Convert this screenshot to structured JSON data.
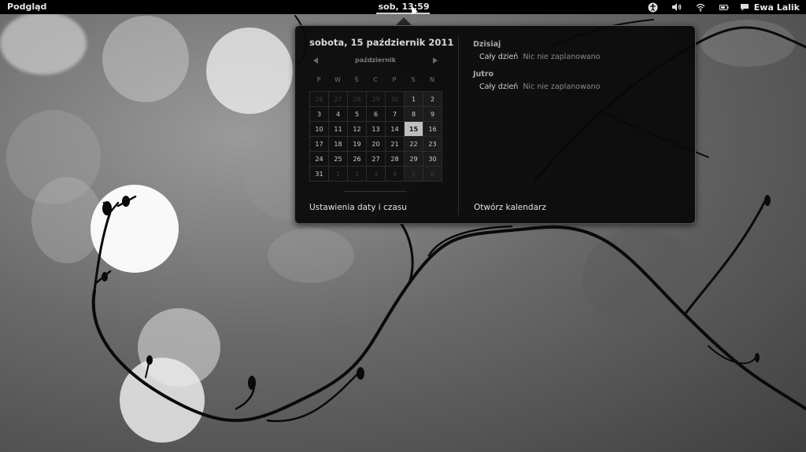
{
  "top_panel": {
    "activities_label": "Podgląd",
    "clock": "sob, 13:59",
    "user_name": "Ewa Lalik",
    "status_icons": [
      "accessibility-icon",
      "volume-icon",
      "wifi-icon",
      "battery-icon",
      "chat-icon"
    ]
  },
  "calendar_popup": {
    "date_title": "sobota, 15 październik 2011",
    "month_label": "październik",
    "weekday_headers": [
      "P",
      "W",
      "Ś",
      "C",
      "P",
      "S",
      "N"
    ],
    "weeks": [
      [
        "26",
        "27",
        "28",
        "29",
        "30",
        "1",
        "2"
      ],
      [
        "3",
        "4",
        "5",
        "6",
        "7",
        "8",
        "9"
      ],
      [
        "10",
        "11",
        "12",
        "13",
        "14",
        "15",
        "16"
      ],
      [
        "17",
        "18",
        "19",
        "20",
        "21",
        "22",
        "23"
      ],
      [
        "24",
        "25",
        "26",
        "27",
        "28",
        "29",
        "30"
      ],
      [
        "31",
        "1",
        "2",
        "3",
        "4",
        "5",
        "6"
      ]
    ],
    "selected_day": "15",
    "events": {
      "today": {
        "label": "Dzisiaj",
        "time": "Cały dzień",
        "description": "Nic nie zaplanowano"
      },
      "tomorrow": {
        "label": "Jutro",
        "time": "Cały dzień",
        "description": "Nic nie zaplanowano"
      }
    },
    "settings_button": "Ustawienia daty i czasu",
    "open_calendar_button": "Otwórz kalendarz"
  },
  "colors": {
    "panel_background": "#000000",
    "popup_background": "#080808",
    "selected_day_background": "#bfbfbf"
  }
}
